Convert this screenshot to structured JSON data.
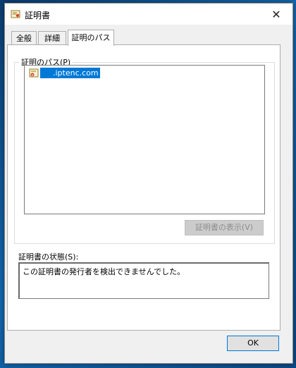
{
  "window": {
    "title": "証明書"
  },
  "tabs": [
    {
      "label": "全般"
    },
    {
      "label": "詳細"
    },
    {
      "label": "証明のパス"
    }
  ],
  "cert_path": {
    "group_label": "証明のパス(P)",
    "items": [
      {
        "label": ".iptenc.com",
        "selected": true
      }
    ],
    "view_button": "証明書の表示(V)"
  },
  "status": {
    "label": "証明書の状態(S):",
    "text": "この証明書の発行者を検出できませんでした。"
  },
  "footer": {
    "ok_label": "OK"
  },
  "colors": {
    "accent": "#0078d7",
    "window_bg": "#f0f0f0",
    "desktop": "#0f4f86"
  }
}
